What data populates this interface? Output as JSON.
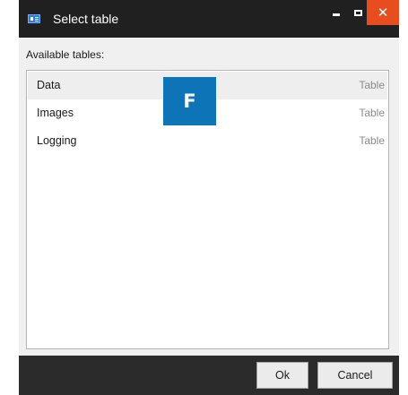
{
  "window": {
    "title": "Select table",
    "app_icon": "table-window-icon",
    "controls": {
      "minimize_icon": "minimize-icon",
      "maximize_icon": "maximize-icon",
      "close_label": "✕"
    }
  },
  "list": {
    "label": "Available tables:",
    "rows": [
      {
        "name": "Data",
        "type": "Table",
        "selected": true
      },
      {
        "name": "Images",
        "type": "Table",
        "selected": false
      },
      {
        "name": "Logging",
        "type": "Table",
        "selected": false
      }
    ]
  },
  "overlay_badge": {
    "letter": "F",
    "color": "#0e74b8"
  },
  "footer": {
    "ok_label": "Ok",
    "cancel_label": "Cancel"
  },
  "colors": {
    "titlebar": "#202020",
    "close_button": "#e84d1f",
    "body": "#f0f0f0",
    "footer": "#2b2b2b"
  }
}
